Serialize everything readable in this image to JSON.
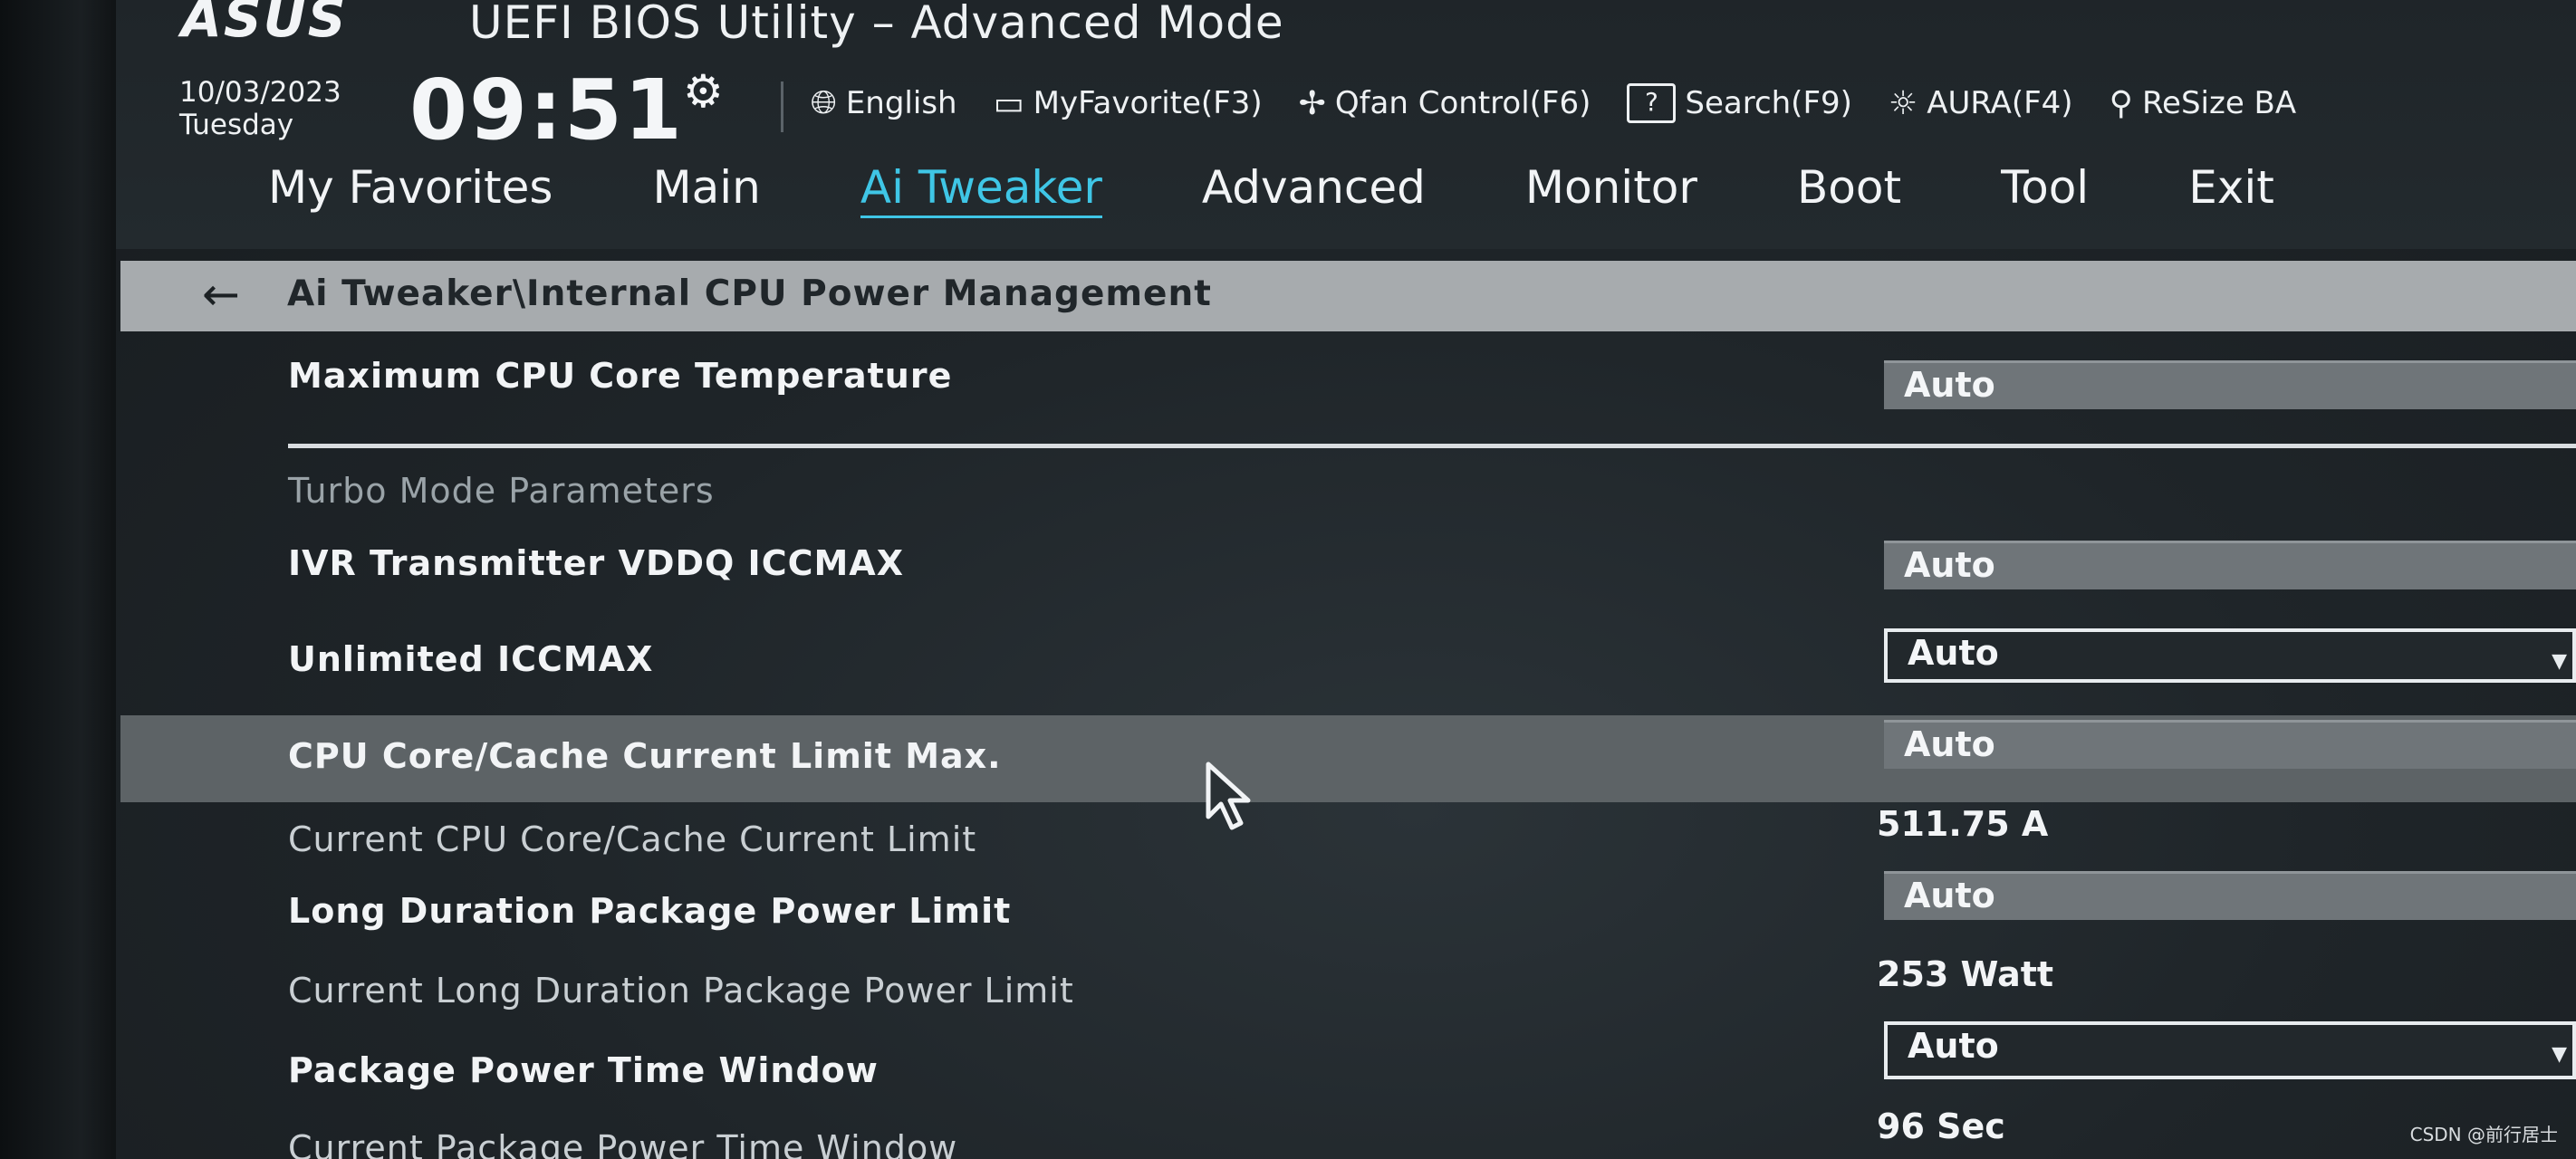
{
  "header": {
    "logo_text": "ASUS",
    "bios_title": "UEFI BIOS Utility – Advanced Mode",
    "date": "10/03/2023",
    "day": "Tuesday",
    "time": "09:51"
  },
  "toolbar": {
    "items": [
      {
        "label": "English",
        "icon": "globe-icon"
      },
      {
        "label": "MyFavorite(F3)",
        "icon": "favorite-icon"
      },
      {
        "label": "Qfan Control(F6)",
        "icon": "fan-icon"
      },
      {
        "label": "Search(F9)",
        "icon": "search-key-icon"
      },
      {
        "label": "AURA(F4)",
        "icon": "aura-icon"
      },
      {
        "label": "ReSize BA",
        "icon": "resize-bar-icon"
      }
    ],
    "search_key_glyph": "?"
  },
  "tabs": [
    {
      "label": "My Favorites",
      "active": false
    },
    {
      "label": "Main",
      "active": false
    },
    {
      "label": "Ai Tweaker",
      "active": true
    },
    {
      "label": "Advanced",
      "active": false
    },
    {
      "label": "Monitor",
      "active": false
    },
    {
      "label": "Boot",
      "active": false
    },
    {
      "label": "Tool",
      "active": false
    },
    {
      "label": "Exit",
      "active": false
    }
  ],
  "breadcrumb": "Ai Tweaker\\Internal CPU Power Management",
  "settings": {
    "max_temp_label": "Maximum CPU Core Temperature",
    "max_temp_value": "Auto",
    "section_label": "Turbo Mode Parameters",
    "ivr_label": "IVR Transmitter VDDQ ICCMAX",
    "ivr_value": "Auto",
    "unlimited_label": "Unlimited ICCMAX",
    "unlimited_value": "Auto",
    "core_cache_label": "CPU Core/Cache Current Limit Max.",
    "core_cache_value": "Auto",
    "current_core_cache_label": "Current CPU Core/Cache Current Limit",
    "current_core_cache_value": "511.75 A",
    "long_duration_label": "Long Duration Package Power Limit",
    "long_duration_value": "Auto",
    "current_long_duration_label": "Current Long Duration Package Power Limit",
    "current_long_duration_value": "253 Watt",
    "time_window_label": "Package Power Time Window",
    "time_window_value": "Auto",
    "current_time_window_label": "Current Package Power Time Window",
    "current_time_window_value": "96 Sec"
  },
  "watermark": "CSDN @前行居士",
  "colors": {
    "accent": "#3fc6e6",
    "breadcrumb_bg": "#a7abae",
    "highlight_row": "#5d6366"
  }
}
